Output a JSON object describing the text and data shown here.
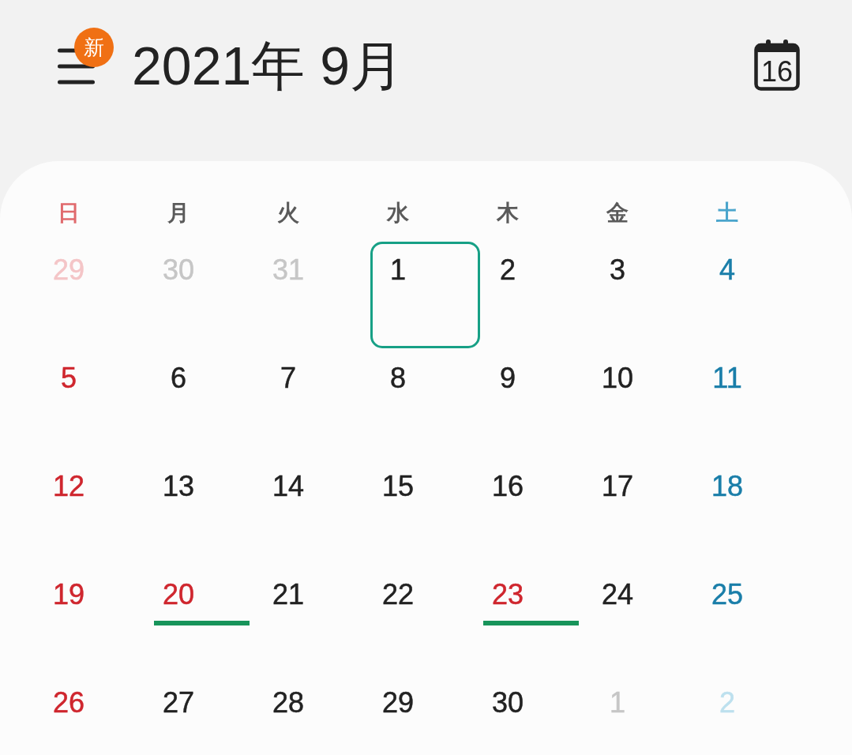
{
  "header": {
    "menu_badge": "新",
    "title": "2021年 9月",
    "today_button": "16"
  },
  "weekdays": [
    {
      "label": "日",
      "kind": "sunday"
    },
    {
      "label": "月",
      "kind": "weekday"
    },
    {
      "label": "火",
      "kind": "weekday"
    },
    {
      "label": "水",
      "kind": "weekday"
    },
    {
      "label": "木",
      "kind": "weekday"
    },
    {
      "label": "金",
      "kind": "weekday"
    },
    {
      "label": "土",
      "kind": "saturday"
    }
  ],
  "weeks": [
    [
      {
        "day": "29",
        "kind": "sunday",
        "outside_month": true,
        "selected": false,
        "event_bar": false
      },
      {
        "day": "30",
        "kind": "weekday",
        "outside_month": true,
        "selected": false,
        "event_bar": false
      },
      {
        "day": "31",
        "kind": "weekday",
        "outside_month": true,
        "selected": false,
        "event_bar": false
      },
      {
        "day": "1",
        "kind": "weekday",
        "outside_month": false,
        "selected": true,
        "event_bar": false
      },
      {
        "day": "2",
        "kind": "weekday",
        "outside_month": false,
        "selected": false,
        "event_bar": false
      },
      {
        "day": "3",
        "kind": "weekday",
        "outside_month": false,
        "selected": false,
        "event_bar": false
      },
      {
        "day": "4",
        "kind": "saturday",
        "outside_month": false,
        "selected": false,
        "event_bar": false
      }
    ],
    [
      {
        "day": "5",
        "kind": "sunday",
        "outside_month": false,
        "selected": false,
        "event_bar": false
      },
      {
        "day": "6",
        "kind": "weekday",
        "outside_month": false,
        "selected": false,
        "event_bar": false
      },
      {
        "day": "7",
        "kind": "weekday",
        "outside_month": false,
        "selected": false,
        "event_bar": false
      },
      {
        "day": "8",
        "kind": "weekday",
        "outside_month": false,
        "selected": false,
        "event_bar": false
      },
      {
        "day": "9",
        "kind": "weekday",
        "outside_month": false,
        "selected": false,
        "event_bar": false
      },
      {
        "day": "10",
        "kind": "weekday",
        "outside_month": false,
        "selected": false,
        "event_bar": false
      },
      {
        "day": "11",
        "kind": "saturday",
        "outside_month": false,
        "selected": false,
        "event_bar": false
      }
    ],
    [
      {
        "day": "12",
        "kind": "sunday",
        "outside_month": false,
        "selected": false,
        "event_bar": false
      },
      {
        "day": "13",
        "kind": "weekday",
        "outside_month": false,
        "selected": false,
        "event_bar": false
      },
      {
        "day": "14",
        "kind": "weekday",
        "outside_month": false,
        "selected": false,
        "event_bar": false
      },
      {
        "day": "15",
        "kind": "weekday",
        "outside_month": false,
        "selected": false,
        "event_bar": false
      },
      {
        "day": "16",
        "kind": "weekday",
        "outside_month": false,
        "selected": false,
        "event_bar": false
      },
      {
        "day": "17",
        "kind": "weekday",
        "outside_month": false,
        "selected": false,
        "event_bar": false
      },
      {
        "day": "18",
        "kind": "saturday",
        "outside_month": false,
        "selected": false,
        "event_bar": false
      }
    ],
    [
      {
        "day": "19",
        "kind": "sunday",
        "outside_month": false,
        "selected": false,
        "event_bar": false
      },
      {
        "day": "20",
        "kind": "holiday",
        "outside_month": false,
        "selected": false,
        "event_bar": true
      },
      {
        "day": "21",
        "kind": "weekday",
        "outside_month": false,
        "selected": false,
        "event_bar": false
      },
      {
        "day": "22",
        "kind": "weekday",
        "outside_month": false,
        "selected": false,
        "event_bar": false
      },
      {
        "day": "23",
        "kind": "holiday",
        "outside_month": false,
        "selected": false,
        "event_bar": true
      },
      {
        "day": "24",
        "kind": "weekday",
        "outside_month": false,
        "selected": false,
        "event_bar": false
      },
      {
        "day": "25",
        "kind": "saturday",
        "outside_month": false,
        "selected": false,
        "event_bar": false
      }
    ],
    [
      {
        "day": "26",
        "kind": "sunday",
        "outside_month": false,
        "selected": false,
        "event_bar": false
      },
      {
        "day": "27",
        "kind": "weekday",
        "outside_month": false,
        "selected": false,
        "event_bar": false
      },
      {
        "day": "28",
        "kind": "weekday",
        "outside_month": false,
        "selected": false,
        "event_bar": false
      },
      {
        "day": "29",
        "kind": "weekday",
        "outside_month": false,
        "selected": false,
        "event_bar": false
      },
      {
        "day": "30",
        "kind": "weekday",
        "outside_month": false,
        "selected": false,
        "event_bar": false
      },
      {
        "day": "1",
        "kind": "weekday",
        "outside_month": true,
        "selected": false,
        "event_bar": false
      },
      {
        "day": "2",
        "kind": "saturday",
        "outside_month": true,
        "selected": false,
        "event_bar": false
      }
    ]
  ]
}
